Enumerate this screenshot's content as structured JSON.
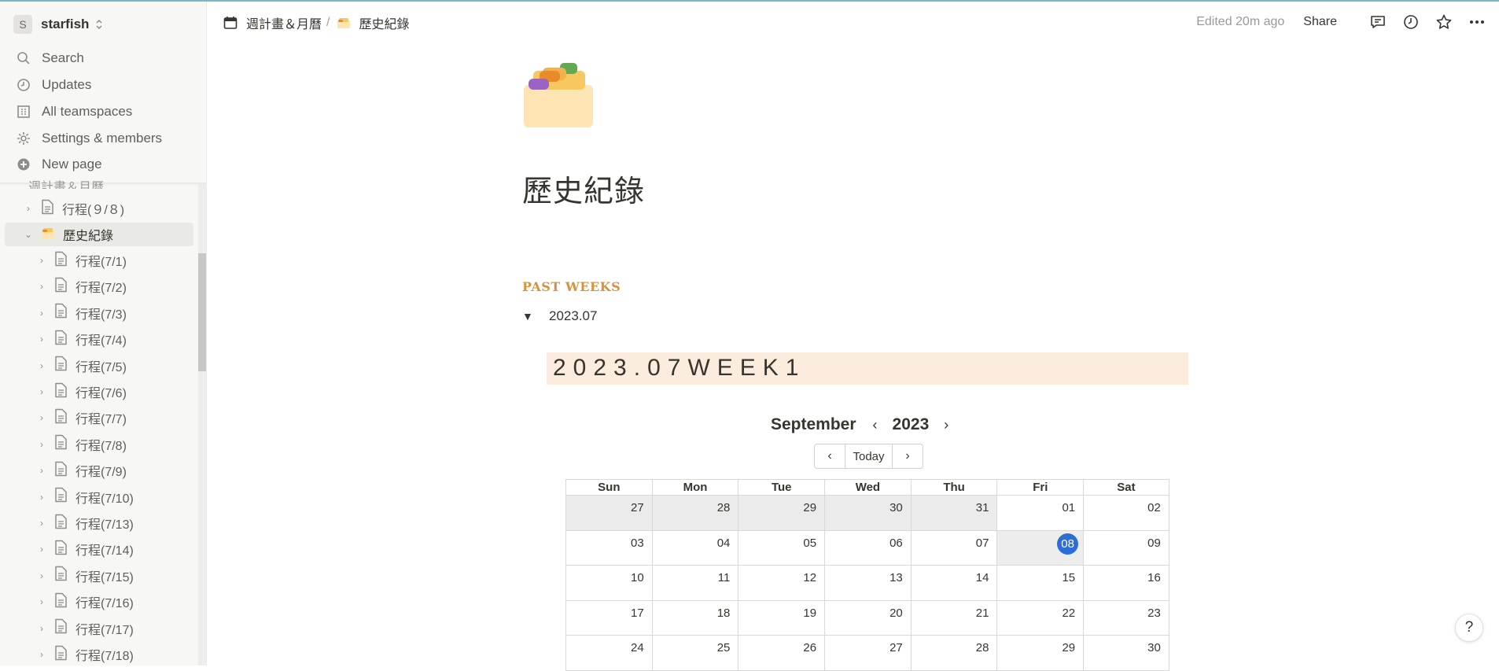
{
  "workspace": {
    "avatar_letter": "S",
    "name": "starfish"
  },
  "sidebar": {
    "menu": [
      {
        "label": "Search",
        "icon": "search-icon"
      },
      {
        "label": "Updates",
        "icon": "clock-icon"
      },
      {
        "label": "All teamspaces",
        "icon": "building-icon"
      },
      {
        "label": "Settings & members",
        "icon": "gear-icon"
      },
      {
        "label": "New page",
        "icon": "plus-circle-icon"
      }
    ],
    "cut_row_label": "週計畫＆月曆",
    "tree": [
      {
        "label": "行程(９/８)",
        "icon": "document-icon",
        "expanded": false
      },
      {
        "label": "歷史紀錄",
        "icon": "folder-emoji-icon",
        "expanded": true,
        "selected": true
      },
      {
        "label": "行程(7/1)"
      },
      {
        "label": "行程(7/2)"
      },
      {
        "label": "行程(7/3)"
      },
      {
        "label": "行程(7/4)"
      },
      {
        "label": "行程(7/5)"
      },
      {
        "label": "行程(7/6)"
      },
      {
        "label": "行程(7/7)"
      },
      {
        "label": "行程(7/8)"
      },
      {
        "label": "行程(7/9)"
      },
      {
        "label": "行程(7/10)"
      },
      {
        "label": "行程(7/13)"
      },
      {
        "label": "行程(7/14)"
      },
      {
        "label": "行程(7/15)"
      },
      {
        "label": "行程(7/16)"
      },
      {
        "label": "行程(7/17)"
      },
      {
        "label": "行程(7/18)"
      }
    ]
  },
  "breadcrumb": {
    "parent": "週計畫＆月曆",
    "separator": "/",
    "current": "歷史紀錄"
  },
  "topbar": {
    "edited": "Edited 20m ago",
    "share": "Share"
  },
  "page": {
    "title": "歷史紀錄",
    "section_heading": "PAST WEEKS",
    "toggle_label": "2023.07",
    "callout_text": "2023.07WEEK1"
  },
  "calendar": {
    "month": "September",
    "year": "2023",
    "today_label": "Today",
    "weekdays": [
      "Sun",
      "Mon",
      "Tue",
      "Wed",
      "Thu",
      "Fri",
      "Sat"
    ],
    "weeks": [
      [
        "27",
        "28",
        "29",
        "30",
        "31",
        "01",
        "02"
      ],
      [
        "03",
        "04",
        "05",
        "06",
        "07",
        "08",
        "09"
      ],
      [
        "10",
        "11",
        "12",
        "13",
        "14",
        "15",
        "16"
      ],
      [
        "17",
        "18",
        "19",
        "20",
        "21",
        "22",
        "23"
      ],
      [
        "24",
        "25",
        "26",
        "27",
        "28",
        "29",
        "30"
      ]
    ],
    "today": "08",
    "accent_color": "#2c6ed6"
  },
  "help_label": "?",
  "colors": {
    "heading_accent": "#d9913b",
    "callout_bg": "#fbecdd",
    "sidebar_bg": "#f7f7f5"
  }
}
